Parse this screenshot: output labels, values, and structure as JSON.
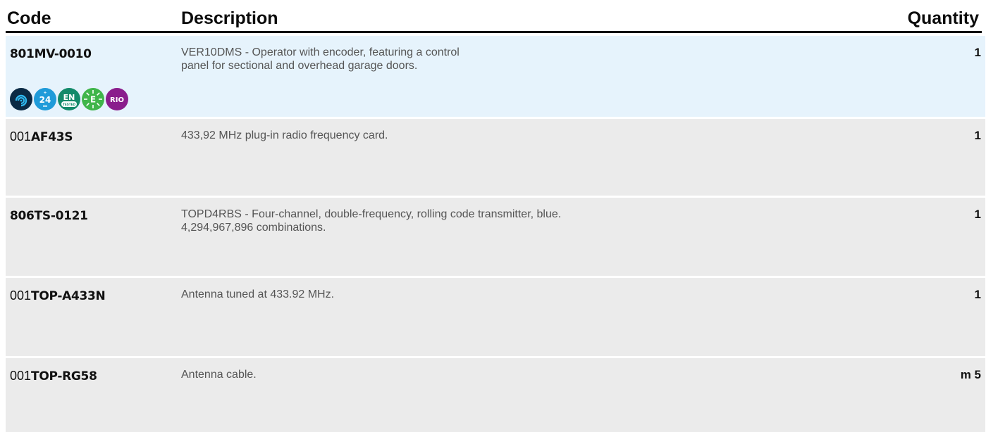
{
  "header": {
    "code_label": "Code",
    "description_label": "Description",
    "quantity_label": "Quantity"
  },
  "rows": [
    {
      "code_prefix": "",
      "code_main": "801MV-0010",
      "description_lines": [
        "VER10DMS - Operator with encoder, featuring a control",
        "panel for sectional and overhead garage doors."
      ],
      "quantity": "1",
      "badges": [
        {
          "icon": "wifi-swirl-icon",
          "text": "",
          "color": "#0b2a45"
        },
        {
          "icon": "24v-icon",
          "text": "24",
          "color": "#1f9bd9"
        },
        {
          "icon": "en-tested-icon",
          "text": "EN",
          "subtext": "TESTED",
          "color": "#138a6a"
        },
        {
          "icon": "energy-saving-icon",
          "text": "E",
          "color": "#3fb54a"
        },
        {
          "icon": "rio-icon",
          "text": "RIO",
          "color": "#8a1d8c"
        }
      ]
    },
    {
      "code_prefix": "001",
      "code_main": "AF43S",
      "description_lines": [
        "433,92 MHz plug-in radio frequency card."
      ],
      "quantity": "1"
    },
    {
      "code_prefix": "",
      "code_main": "806TS-0121",
      "description_lines": [
        "TOPD4RBS - Four-channel, double-frequency, rolling code transmitter, blue.",
        "4,294,967,896 combinations."
      ],
      "quantity": "1"
    },
    {
      "code_prefix": "001",
      "code_main": "TOP-A433N",
      "description_lines": [
        "Antenna tuned at 433.92 MHz."
      ],
      "quantity": "1"
    },
    {
      "code_prefix": "001",
      "code_main": "TOP-RG58",
      "description_lines": [
        "Antenna cable."
      ],
      "quantity": "m 5"
    }
  ]
}
